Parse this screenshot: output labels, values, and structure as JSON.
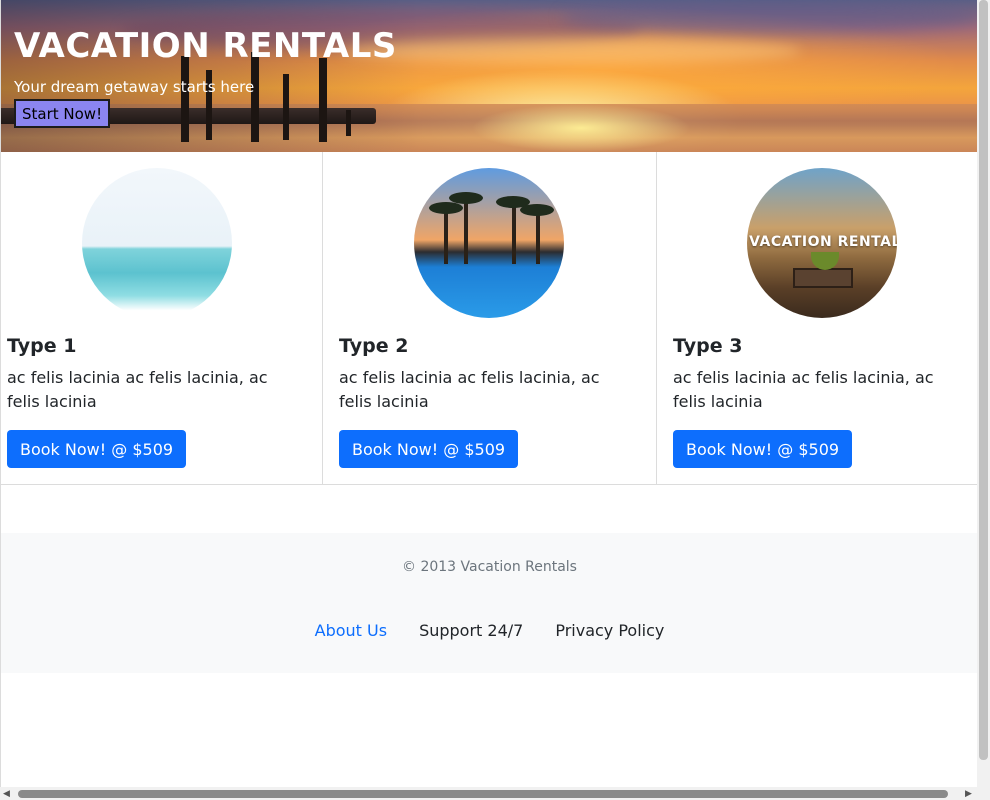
{
  "hero": {
    "title": "VACATION RENTALS",
    "subtitle": "Your dream getaway starts here",
    "button_label": "Start Now!",
    "button_color": "#8b85f0"
  },
  "cards": [
    {
      "title": "Type 1",
      "text": "ac felis lacinia ac felis lacinia, ac felis lacinia",
      "button_label": "Book Now! @ $509",
      "image": "sea-image"
    },
    {
      "title": "Type 2",
      "text": "ac felis lacinia ac felis lacinia, ac felis lacinia",
      "button_label": "Book Now! @ $509",
      "image": "pool-image"
    },
    {
      "title": "Type 3",
      "text": "ac felis lacinia ac felis lacinia, ac felis lacinia",
      "button_label": "Book Now! @ $509",
      "image": "vacation-rental-image",
      "image_text": "VACATION RENTAL"
    }
  ],
  "footer": {
    "copyright": "© 2013 Vacation Rentals",
    "links": [
      "About Us",
      "Support 24/7",
      "Privacy Policy"
    ]
  },
  "colors": {
    "primary": "#0d6efd",
    "footer_bg": "#f8f9fa"
  }
}
